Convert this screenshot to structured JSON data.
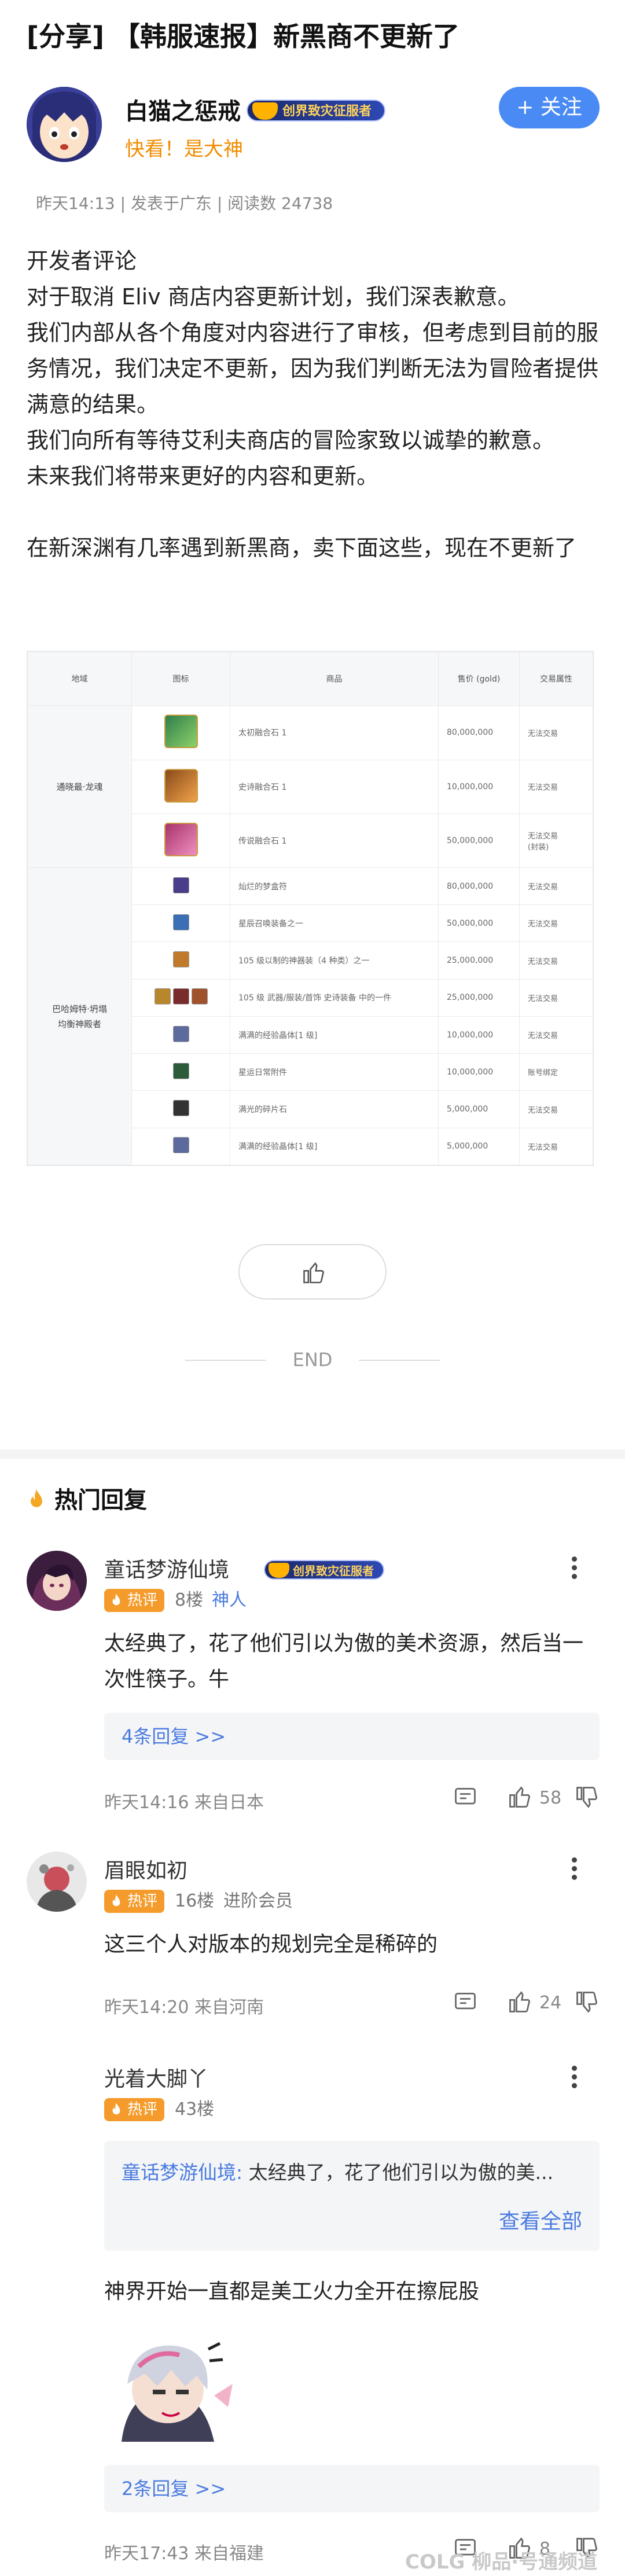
{
  "post": {
    "title": "[分享] 【韩服速报】新黑商不更新了",
    "author": "白猫之惩戒",
    "badge": "创界致灾征服者",
    "author_sub": "快看！是大神",
    "follow": "+ 关注",
    "meta": "昨天14:13 | 发表于广东 | 阅读数 24738",
    "paragraphs": [
      "开发者评论",
      "对于取消 Eliv 商店内容更新计划，我们深表歉意。",
      "我们内部从各个角度对内容进行了审核，但考虑到目前的服务情况，我们决定不更新，因为我们判断无法为冒险者提供满意的结果。",
      "我们向所有等待艾利夫商店的冒险家致以诚挚的歉意。",
      "未来我们将带来更好的内容和更新。",
      "在新深渊有几率遇到新黑商，卖下面这些，现在不更新了"
    ],
    "end": "END",
    "hot_title": "热门回复"
  },
  "table": {
    "headers": [
      "地域",
      "图标",
      "商品",
      "售价 (gold)",
      "交易属性"
    ],
    "group1": "通晓最·龙魂",
    "group2": "巴哈姆特·坍塌\n均衡神殿者",
    "rows1": [
      {
        "name": "太初融合石 1",
        "price": "80,000,000",
        "trade": "无法交易"
      },
      {
        "name": "史诗融合石 1",
        "price": "10,000,000",
        "trade": "无法交易"
      },
      {
        "name": "传说融合石 1",
        "price": "50,000,000",
        "trade": "无法交易\n(封装)"
      }
    ],
    "rows2": [
      {
        "name": "灿烂的梦盒符",
        "price": "80,000,000",
        "trade": "无法交易"
      },
      {
        "name": "星辰召唤装备之一",
        "price": "50,000,000",
        "trade": "无法交易"
      },
      {
        "name": "105 级以制的神器装（4 种类）之一",
        "price": "25,000,000",
        "trade": "无法交易"
      },
      {
        "name": "105 级 武器/服装/首饰 史诗装备 中的一件",
        "price": "25,000,000",
        "trade": "无法交易"
      },
      {
        "name": "满满的经验晶体[1 级]",
        "price": "10,000,000",
        "trade": "无法交易"
      },
      {
        "name": "星运日常附件",
        "price": "10,000,000",
        "trade": "账号绑定"
      },
      {
        "name": "满光的碎片石",
        "price": "5,000,000",
        "trade": "无法交易"
      },
      {
        "name": "满满的经验晶体[1 级]",
        "price": "5,000,000",
        "trade": "无法交易"
      }
    ]
  },
  "comments": [
    {
      "name": "童话梦游仙境",
      "badge": "创界致灾征服者",
      "tag": "热评",
      "floor": "8楼",
      "role": "神人",
      "text": "太经典了，花了他们引以为傲的美术资源，然后当一次性筷子。牛",
      "replies": "4条回复 >>",
      "time": "昨天14:16 来自日本",
      "likes": "58"
    },
    {
      "name": "眉眼如初",
      "tag": "热评",
      "floor": "16楼",
      "role": "进阶会员",
      "text": "这三个人对版本的规划完全是稀碎的",
      "time": "昨天14:20 来自河南",
      "likes": "24"
    },
    {
      "name": "光着大脚丫",
      "tag": "热评",
      "floor": "43楼",
      "quote_name": "童话梦游仙境:",
      "quote_text": " 太经典了，花了他们引以为傲的美...",
      "quote_more": "查看全部",
      "text": "神界开始一直都是美工火力全开在擦屁股",
      "replies": "2条回复 >>",
      "time": "昨天17:43 来自福建",
      "likes": "8"
    }
  ],
  "watermark": "COLG 柳品·号通频道"
}
